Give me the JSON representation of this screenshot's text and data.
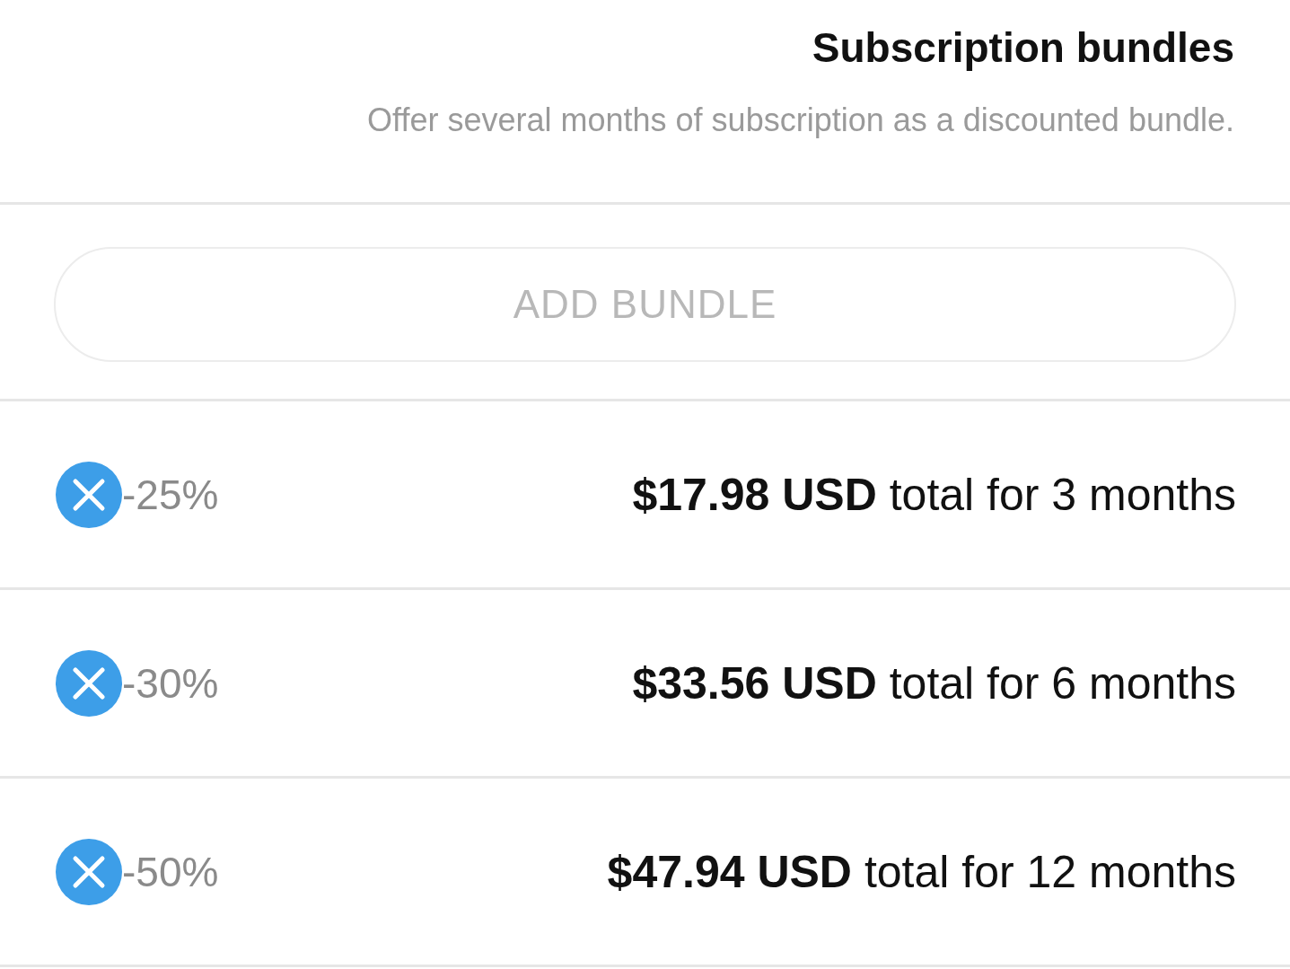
{
  "header": {
    "title": "Subscription bundles",
    "subtitle": "Offer several months of subscription as a discounted bundle."
  },
  "add_button": {
    "label": "ADD BUNDLE"
  },
  "bundles": [
    {
      "price": "**$17.98 USD** total for 3 months",
      "discount": "-25%"
    },
    {
      "price": "**$33.56 USD** total for 6 months",
      "discount": "-30%"
    },
    {
      "price": "**$47.94 USD** total for 12 months",
      "discount": "-50%"
    }
  ]
}
